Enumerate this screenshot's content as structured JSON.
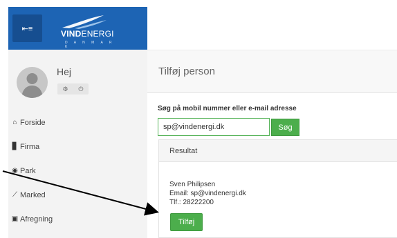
{
  "brand": {
    "name_bold": "VIND",
    "name_thin": "ENERGI",
    "subtitle": "D A N M A R K",
    "toggle_icon": "⇤≡"
  },
  "user": {
    "greeting": "Hej",
    "settings_icon": "⚙",
    "power_icon": "⏻"
  },
  "nav": {
    "items": [
      {
        "icon": "home-icon",
        "glyph": "⌂",
        "label": "Forside"
      },
      {
        "icon": "building-icon",
        "glyph": "▊",
        "label": "Firma"
      },
      {
        "icon": "dashboard-icon",
        "glyph": "◉",
        "label": "Park"
      },
      {
        "icon": "line-chart-icon",
        "glyph": "⟋",
        "label": "Marked"
      },
      {
        "icon": "money-icon",
        "glyph": "▣",
        "label": "Afregning"
      }
    ]
  },
  "page": {
    "title": "Tilføj person"
  },
  "search": {
    "label": "Søg på mobil nummer eller e-mail adresse",
    "value": "sp@vindenergi.dk",
    "button_label": "Søg"
  },
  "result": {
    "header": "Resultat",
    "name": "Sven Philipsen",
    "email": "Email: sp@vindenergi.dk",
    "phone": "Tlf.: 28222200",
    "add_button_label": "Tilføj"
  },
  "colors": {
    "brand_blue": "#1d64b4",
    "success_green": "#4cae4c"
  }
}
